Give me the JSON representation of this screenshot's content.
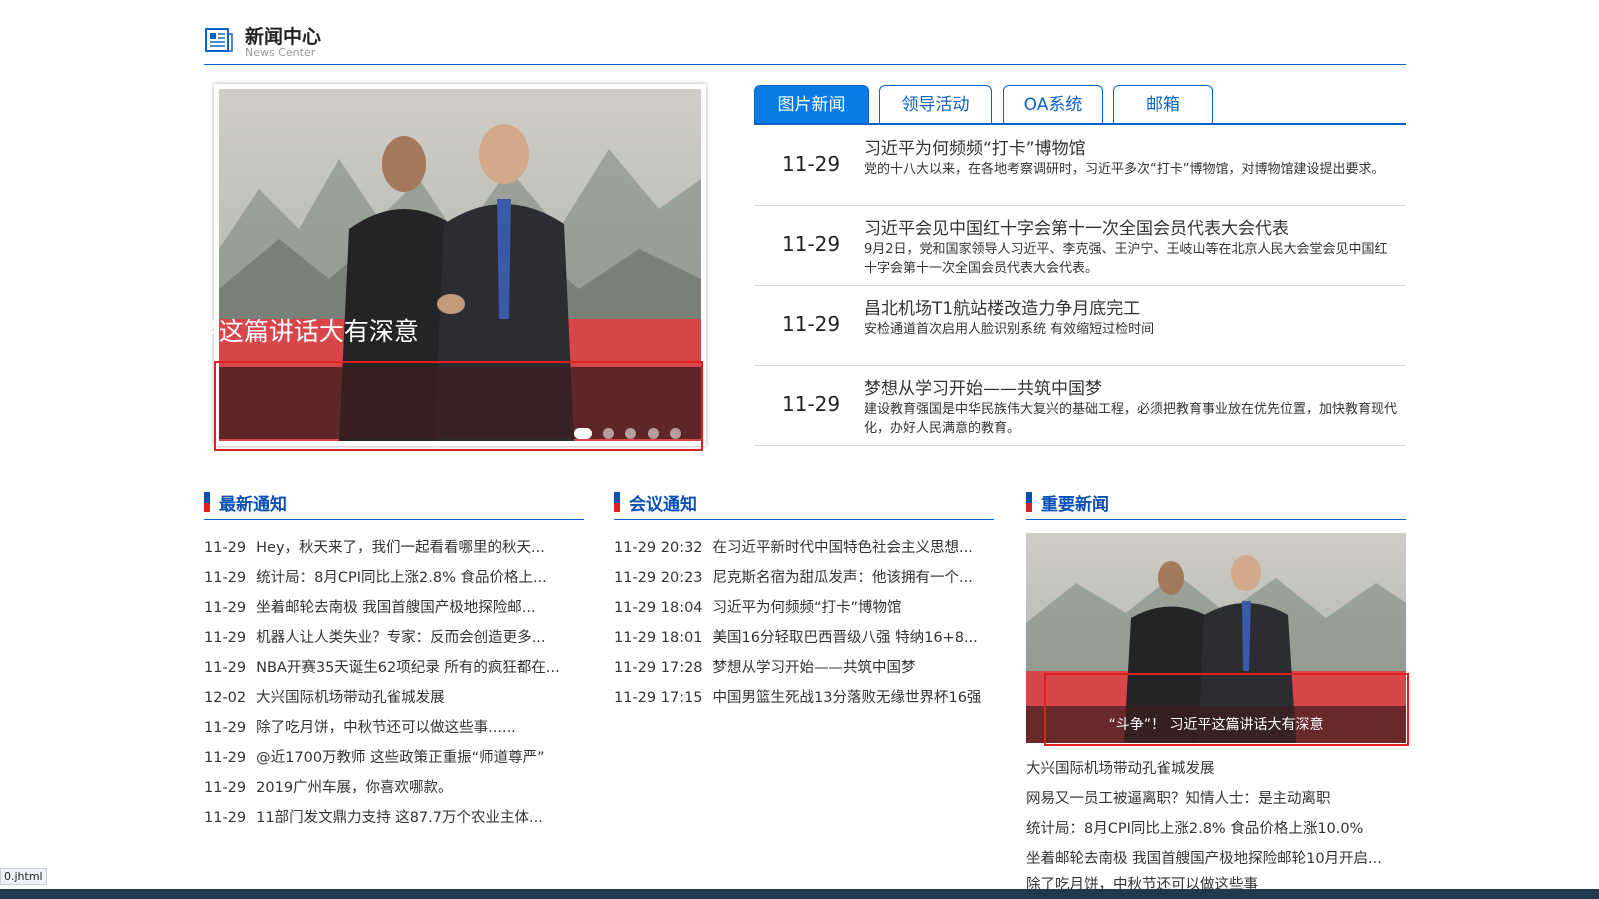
{
  "header": {
    "title": "新闻中心",
    "subtitle": "News Center",
    "icon": "news-icon"
  },
  "slider": {
    "caption": "“斗争”！ 习近平这篇讲话大有深意",
    "dots": 5,
    "active_dot": 1
  },
  "tabs": [
    {
      "label": "图片新闻",
      "active": true
    },
    {
      "label": "领导活动",
      "active": false
    },
    {
      "label": "OA系统",
      "active": false
    },
    {
      "label": "邮箱",
      "active": false
    }
  ],
  "news": [
    {
      "date": "11-29",
      "title": "习近平为何频频“打卡”博物馆",
      "desc": "党的十八大以来，在各地考察调研时，习近平多次“打卡”博物馆，对博物馆建设提出要求。"
    },
    {
      "date": "11-29",
      "title": "习近平会见中国红十字会第十一次全国会员代表大会代表",
      "desc": "9月2日，党和国家领导人习近平、李克强、王沪宁、王岐山等在北京人民大会堂会见中国红十字会第十一次全国会员代表大会代表。"
    },
    {
      "date": "11-29",
      "title": "昌北机场T1航站楼改造力争月底完工",
      "desc": "安检通道首次启用人脸识别系统 有效缩短过检时间"
    },
    {
      "date": "11-29",
      "title": "梦想从学习开始——共筑中国梦",
      "desc": "建设教育强国是中华民族伟大复兴的基础工程，必须把教育事业放在优先位置，加快教育现代化，办好人民满意的教育。"
    }
  ],
  "latest": {
    "title": "最新通知",
    "items": [
      {
        "date": "11-29",
        "text": "Hey，秋天来了，我们一起看看哪里的秋天..."
      },
      {
        "date": "11-29",
        "text": "统计局：8月CPI同比上涨2.8% 食品价格上..."
      },
      {
        "date": "11-29",
        "text": "坐着邮轮去南极 我国首艘国产极地探险邮..."
      },
      {
        "date": "11-29",
        "text": "机器人让人类失业？专家：反而会创造更多..."
      },
      {
        "date": "11-29",
        "text": "NBA开赛35天诞生62项纪录 所有的疯狂都在..."
      },
      {
        "date": "12-02",
        "text": "大兴国际机场带动孔雀城发展"
      },
      {
        "date": "11-29",
        "text": "除了吃月饼，中秋节还可以做这些事......"
      },
      {
        "date": "11-29",
        "text": "@近1700万教师 这些政策正重振“师道尊严”"
      },
      {
        "date": "11-29",
        "text": "2019广州车展，你喜欢哪款。"
      },
      {
        "date": "11-29",
        "text": "11部门发文鼎力支持 这87.7万个农业主体..."
      }
    ]
  },
  "meetings": {
    "title": "会议通知",
    "items": [
      {
        "date": "11-29 20:32",
        "text": "在习近平新时代中国特色社会主义思想..."
      },
      {
        "date": "11-29 20:23",
        "text": "尼克斯名宿为甜瓜发声：他该拥有一个..."
      },
      {
        "date": "11-29 18:04",
        "text": "习近平为何频频“打卡”博物馆"
      },
      {
        "date": "11-29 18:01",
        "text": "美国16分轻取巴西晋级八强 特纳16+8..."
      },
      {
        "date": "11-29 17:28",
        "text": "梦想从学习开始——共筑中国梦"
      },
      {
        "date": "11-29 17:15",
        "text": "中国男篮生死战13分落败无缘世界杯16强"
      }
    ]
  },
  "important": {
    "title": "重要新闻",
    "caption": "“斗争”！ 习近平这篇讲话大有深意",
    "items": [
      "大兴国际机场带动孔雀城发展",
      "网易又一员工被逼离职？知情人士：是主动离职",
      "统计局：8月CPI同比上涨2.8% 食品价格上涨10.0%",
      "坐着邮轮去南极 我国首艘国产极地探险邮轮10月开启...",
      "除了吃月饼，中秋节还可以做这些事"
    ]
  },
  "status_url": "0.jhtml",
  "colors": {
    "accent": "#0a63c6",
    "tab_active": "#0a7ae6",
    "highlight": "#e02020"
  }
}
